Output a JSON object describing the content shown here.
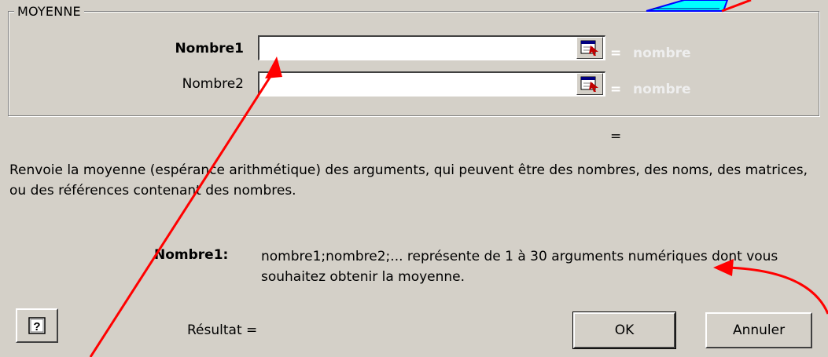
{
  "dialog": {
    "function_name": "MOYENNE",
    "args": [
      {
        "label": "Nombre1",
        "value": "",
        "hint": "nombre"
      },
      {
        "label": "Nombre2",
        "value": "",
        "hint": "nombre"
      }
    ],
    "equals": "=",
    "formula_result": "",
    "description": "Renvoie la moyenne (espérance arithmétique) des arguments, qui peuvent être des nombres, des noms, des matrices, ou des références contenant des nombres.",
    "arg_help": {
      "name": "Nombre1:",
      "text": "nombre1;nombre2;... représente de 1 à 30 arguments numériques dont vous souhaitez obtenir la moyenne."
    },
    "result_label": "Résultat =",
    "ok_label": "OK",
    "cancel_label": "Annuler",
    "help_icon": "help-question-icon",
    "ref_icon": "collapse-dialog-icon"
  },
  "colors": {
    "dialog_bg": "#d4d0c8",
    "annotation": "#ff0000",
    "shape_fill": "#00ffff"
  }
}
